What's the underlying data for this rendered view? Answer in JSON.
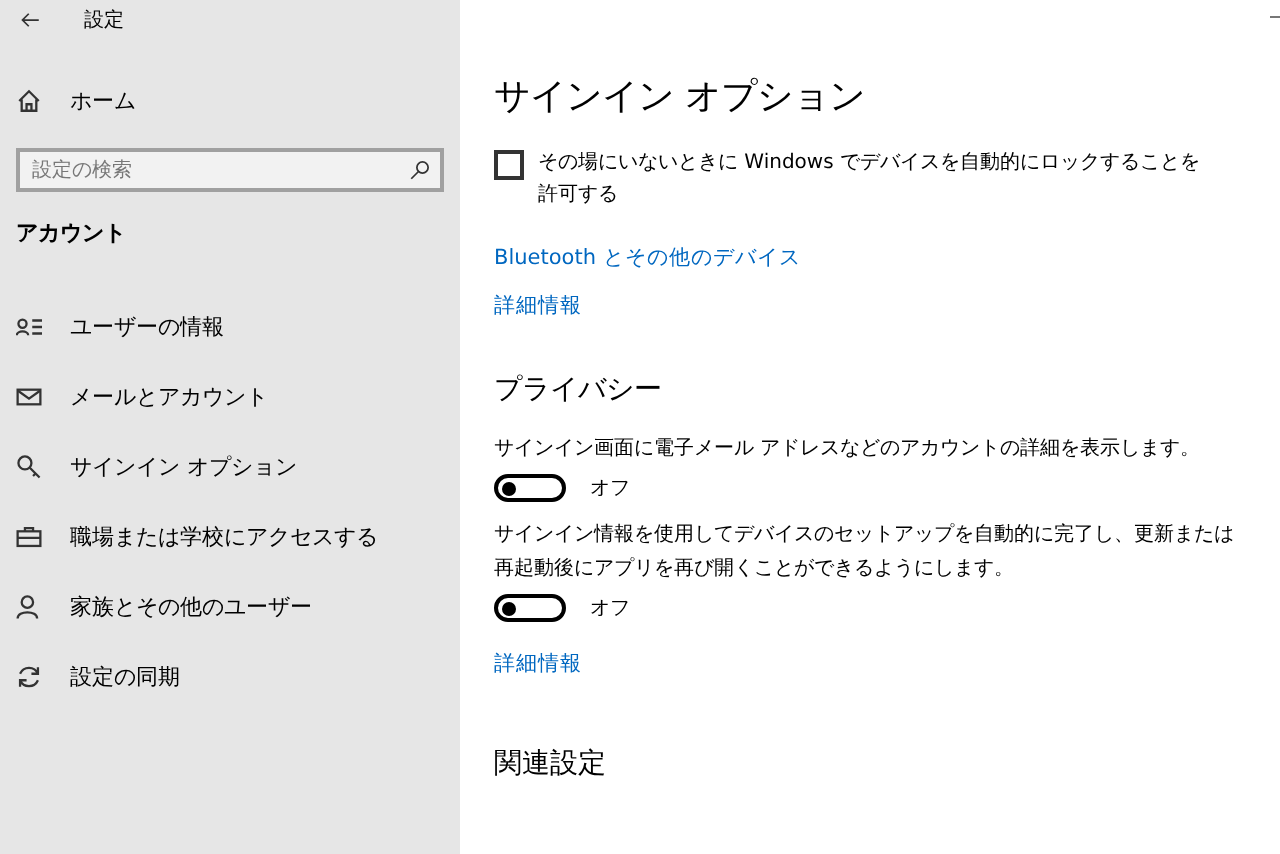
{
  "window": {
    "title": "設定"
  },
  "sidebar": {
    "home": "ホーム",
    "search": {
      "placeholder": "設定の検索"
    },
    "section": "アカウント",
    "items": [
      {
        "label": "ユーザーの情報"
      },
      {
        "label": "メールとアカウント"
      },
      {
        "label": "サインイン オプション"
      },
      {
        "label": "職場または学校にアクセスする"
      },
      {
        "label": "家族とその他のユーザー"
      },
      {
        "label": "設定の同期"
      }
    ]
  },
  "main": {
    "title": "サインイン オプション",
    "lock_checkbox": {
      "label": "その場にいないときに Windows でデバイスを自動的にロックすることを許可する",
      "checked": false
    },
    "links": [
      "Bluetooth とその他のデバイス",
      "詳細情報"
    ],
    "privacy": {
      "heading": "プライバシー",
      "settings": [
        {
          "description": "サインイン画面に電子メール アドレスなどのアカウントの詳細を表示します。",
          "on": false,
          "state_label": "オフ"
        },
        {
          "description": "サインイン情報を使用してデバイスのセットアップを自動的に完了し、更新または再起動後にアプリを再び開くことができるようにします。",
          "on": false,
          "state_label": "オフ"
        }
      ],
      "link": "詳細情報"
    },
    "related_heading": "関連設定"
  }
}
